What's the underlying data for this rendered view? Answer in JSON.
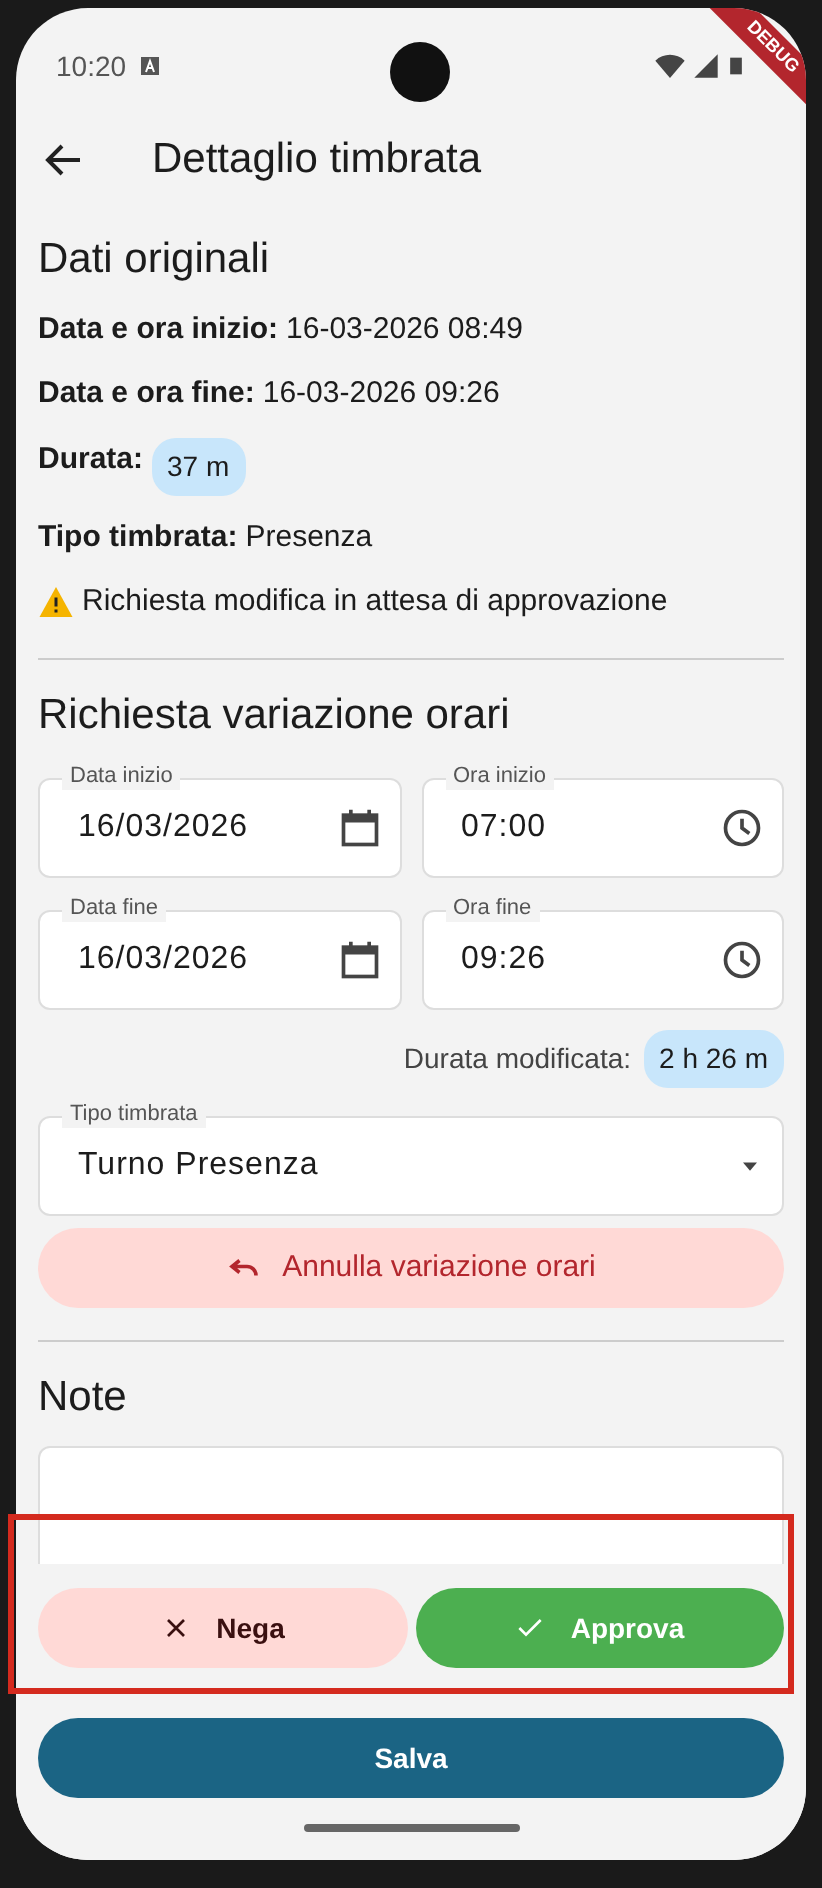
{
  "status_bar": {
    "time": "10:20"
  },
  "debug_banner": "DEBUG",
  "app_bar": {
    "title": "Dettaglio timbrata"
  },
  "original": {
    "title": "Dati originali",
    "rows": [
      {
        "label": "Data e ora inizio:",
        "value": "16-03-2026 08:49",
        "kind": "text"
      },
      {
        "label": "Data e ora fine:",
        "value": "16-03-2026 09:26",
        "kind": "text"
      },
      {
        "label": "Durata:",
        "value": "37 m",
        "kind": "chip"
      },
      {
        "label": "Tipo timbrata:",
        "value": "Presenza",
        "kind": "text"
      }
    ],
    "warning": "Richiesta modifica in attesa di approvazione"
  },
  "change_request": {
    "title": "Richiesta variazione orari",
    "fields": [
      {
        "label": "Data inizio",
        "value": "16/03/2026",
        "kind": "date"
      },
      {
        "label": "Ora inizio",
        "value": "07:00",
        "kind": "time"
      },
      {
        "label": "Data fine",
        "value": "16/03/2026",
        "kind": "date"
      },
      {
        "label": "Ora fine",
        "value": "09:26",
        "kind": "time"
      }
    ],
    "duration_label": "Durata modificata:",
    "duration_value": "2 h 26 m",
    "type_select": {
      "label": "Tipo timbrata",
      "value": "Turno Presenza"
    },
    "cancel_button": "Annulla variazione orari"
  },
  "notes": {
    "title": "Note"
  },
  "actions": [
    {
      "label": "Nega",
      "kind": "deny"
    },
    {
      "label": "Approva",
      "kind": "approve"
    }
  ],
  "save_button": "Salva"
}
